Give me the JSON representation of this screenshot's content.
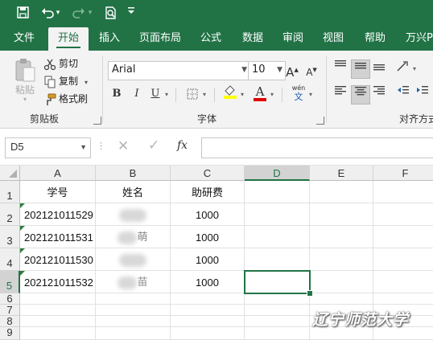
{
  "titlebar": {
    "quick_access": [
      "save-icon",
      "undo-icon",
      "redo-icon",
      "print-preview-icon",
      "customize-icon"
    ]
  },
  "tabs": [
    {
      "label": "文件",
      "active": false
    },
    {
      "label": "开始",
      "active": true
    },
    {
      "label": "插入",
      "active": false
    },
    {
      "label": "页面布局",
      "active": false
    },
    {
      "label": "公式",
      "active": false
    },
    {
      "label": "数据",
      "active": false
    },
    {
      "label": "审阅",
      "active": false
    },
    {
      "label": "视图",
      "active": false
    },
    {
      "label": "帮助",
      "active": false
    },
    {
      "label": "万兴PD",
      "active": false
    }
  ],
  "ribbon": {
    "clipboard": {
      "paste_label": "粘贴",
      "cut_label": "剪切",
      "copy_label": "复制",
      "format_painter_label": "格式刷",
      "group_label": "剪贴板"
    },
    "font": {
      "font_name": "Arial",
      "font_size": "10",
      "bold": "B",
      "italic": "I",
      "underline": "U",
      "phonetic_top": "wén",
      "phonetic_bottom": "文",
      "group_label": "字体"
    },
    "alignment": {
      "group_label": "对齐方式"
    }
  },
  "formula_bar": {
    "name_box": "D5",
    "fx_label": "fx"
  },
  "columns": [
    "A",
    "B",
    "C",
    "D",
    "E",
    "F"
  ],
  "selected_column": "D",
  "rows": [
    "1",
    "2",
    "3",
    "4",
    "5",
    "6",
    "7",
    "8",
    "9"
  ],
  "selected_row": "5",
  "table": {
    "headers": [
      "学号",
      "姓名",
      "助研费"
    ],
    "records": [
      {
        "id": "202121011529",
        "name": "",
        "fee": "1000"
      },
      {
        "id": "202121011531",
        "name": "萌",
        "fee": "1000"
      },
      {
        "id": "202121011530",
        "name": "",
        "fee": "1000"
      },
      {
        "id": "202121011532",
        "name": "苗",
        "fee": "1000"
      }
    ]
  },
  "watermark": "辽宁师范大学",
  "colors": {
    "accent": "#217346",
    "indicator": "#2f7d3e"
  }
}
